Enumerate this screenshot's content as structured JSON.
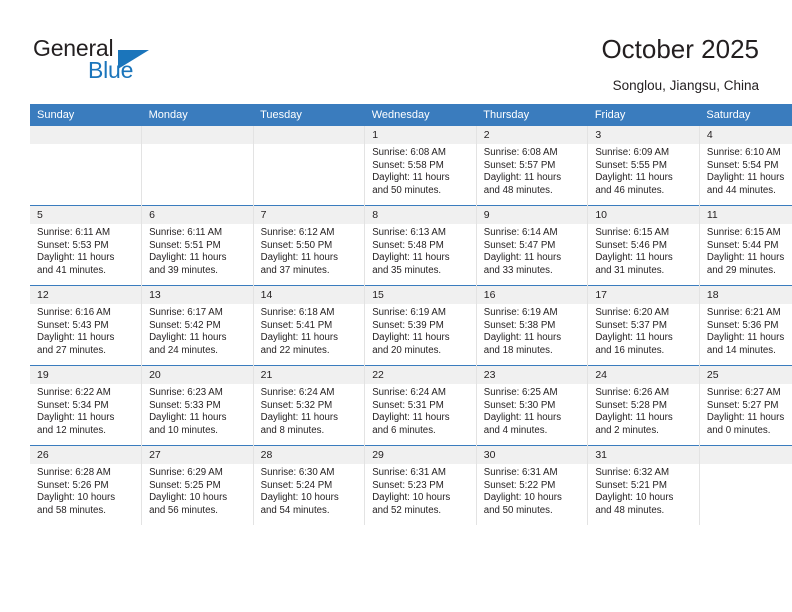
{
  "brand": {
    "name_top": "General",
    "name_bottom": "Blue",
    "accent_color": "#1b75bb"
  },
  "header": {
    "title": "October 2025",
    "subtitle": "Songlou, Jiangsu, China",
    "header_bg_color": "#3a7cbe",
    "daynum_band_color": "#f0f0f0"
  },
  "weekday_headers": [
    "Sunday",
    "Monday",
    "Tuesday",
    "Wednesday",
    "Thursday",
    "Friday",
    "Saturday"
  ],
  "weeks": [
    [
      {
        "day": "",
        "sunrise": "",
        "sunset": "",
        "daylight_line1": "",
        "daylight_line2": ""
      },
      {
        "day": "",
        "sunrise": "",
        "sunset": "",
        "daylight_line1": "",
        "daylight_line2": ""
      },
      {
        "day": "",
        "sunrise": "",
        "sunset": "",
        "daylight_line1": "",
        "daylight_line2": ""
      },
      {
        "day": "1",
        "sunrise": "Sunrise: 6:08 AM",
        "sunset": "Sunset: 5:58 PM",
        "daylight_line1": "Daylight: 11 hours",
        "daylight_line2": "and 50 minutes."
      },
      {
        "day": "2",
        "sunrise": "Sunrise: 6:08 AM",
        "sunset": "Sunset: 5:57 PM",
        "daylight_line1": "Daylight: 11 hours",
        "daylight_line2": "and 48 minutes."
      },
      {
        "day": "3",
        "sunrise": "Sunrise: 6:09 AM",
        "sunset": "Sunset: 5:55 PM",
        "daylight_line1": "Daylight: 11 hours",
        "daylight_line2": "and 46 minutes."
      },
      {
        "day": "4",
        "sunrise": "Sunrise: 6:10 AM",
        "sunset": "Sunset: 5:54 PM",
        "daylight_line1": "Daylight: 11 hours",
        "daylight_line2": "and 44 minutes."
      }
    ],
    [
      {
        "day": "5",
        "sunrise": "Sunrise: 6:11 AM",
        "sunset": "Sunset: 5:53 PM",
        "daylight_line1": "Daylight: 11 hours",
        "daylight_line2": "and 41 minutes."
      },
      {
        "day": "6",
        "sunrise": "Sunrise: 6:11 AM",
        "sunset": "Sunset: 5:51 PM",
        "daylight_line1": "Daylight: 11 hours",
        "daylight_line2": "and 39 minutes."
      },
      {
        "day": "7",
        "sunrise": "Sunrise: 6:12 AM",
        "sunset": "Sunset: 5:50 PM",
        "daylight_line1": "Daylight: 11 hours",
        "daylight_line2": "and 37 minutes."
      },
      {
        "day": "8",
        "sunrise": "Sunrise: 6:13 AM",
        "sunset": "Sunset: 5:48 PM",
        "daylight_line1": "Daylight: 11 hours",
        "daylight_line2": "and 35 minutes."
      },
      {
        "day": "9",
        "sunrise": "Sunrise: 6:14 AM",
        "sunset": "Sunset: 5:47 PM",
        "daylight_line1": "Daylight: 11 hours",
        "daylight_line2": "and 33 minutes."
      },
      {
        "day": "10",
        "sunrise": "Sunrise: 6:15 AM",
        "sunset": "Sunset: 5:46 PM",
        "daylight_line1": "Daylight: 11 hours",
        "daylight_line2": "and 31 minutes."
      },
      {
        "day": "11",
        "sunrise": "Sunrise: 6:15 AM",
        "sunset": "Sunset: 5:44 PM",
        "daylight_line1": "Daylight: 11 hours",
        "daylight_line2": "and 29 minutes."
      }
    ],
    [
      {
        "day": "12",
        "sunrise": "Sunrise: 6:16 AM",
        "sunset": "Sunset: 5:43 PM",
        "daylight_line1": "Daylight: 11 hours",
        "daylight_line2": "and 27 minutes."
      },
      {
        "day": "13",
        "sunrise": "Sunrise: 6:17 AM",
        "sunset": "Sunset: 5:42 PM",
        "daylight_line1": "Daylight: 11 hours",
        "daylight_line2": "and 24 minutes."
      },
      {
        "day": "14",
        "sunrise": "Sunrise: 6:18 AM",
        "sunset": "Sunset: 5:41 PM",
        "daylight_line1": "Daylight: 11 hours",
        "daylight_line2": "and 22 minutes."
      },
      {
        "day": "15",
        "sunrise": "Sunrise: 6:19 AM",
        "sunset": "Sunset: 5:39 PM",
        "daylight_line1": "Daylight: 11 hours",
        "daylight_line2": "and 20 minutes."
      },
      {
        "day": "16",
        "sunrise": "Sunrise: 6:19 AM",
        "sunset": "Sunset: 5:38 PM",
        "daylight_line1": "Daylight: 11 hours",
        "daylight_line2": "and 18 minutes."
      },
      {
        "day": "17",
        "sunrise": "Sunrise: 6:20 AM",
        "sunset": "Sunset: 5:37 PM",
        "daylight_line1": "Daylight: 11 hours",
        "daylight_line2": "and 16 minutes."
      },
      {
        "day": "18",
        "sunrise": "Sunrise: 6:21 AM",
        "sunset": "Sunset: 5:36 PM",
        "daylight_line1": "Daylight: 11 hours",
        "daylight_line2": "and 14 minutes."
      }
    ],
    [
      {
        "day": "19",
        "sunrise": "Sunrise: 6:22 AM",
        "sunset": "Sunset: 5:34 PM",
        "daylight_line1": "Daylight: 11 hours",
        "daylight_line2": "and 12 minutes."
      },
      {
        "day": "20",
        "sunrise": "Sunrise: 6:23 AM",
        "sunset": "Sunset: 5:33 PM",
        "daylight_line1": "Daylight: 11 hours",
        "daylight_line2": "and 10 minutes."
      },
      {
        "day": "21",
        "sunrise": "Sunrise: 6:24 AM",
        "sunset": "Sunset: 5:32 PM",
        "daylight_line1": "Daylight: 11 hours",
        "daylight_line2": "and 8 minutes."
      },
      {
        "day": "22",
        "sunrise": "Sunrise: 6:24 AM",
        "sunset": "Sunset: 5:31 PM",
        "daylight_line1": "Daylight: 11 hours",
        "daylight_line2": "and 6 minutes."
      },
      {
        "day": "23",
        "sunrise": "Sunrise: 6:25 AM",
        "sunset": "Sunset: 5:30 PM",
        "daylight_line1": "Daylight: 11 hours",
        "daylight_line2": "and 4 minutes."
      },
      {
        "day": "24",
        "sunrise": "Sunrise: 6:26 AM",
        "sunset": "Sunset: 5:28 PM",
        "daylight_line1": "Daylight: 11 hours",
        "daylight_line2": "and 2 minutes."
      },
      {
        "day": "25",
        "sunrise": "Sunrise: 6:27 AM",
        "sunset": "Sunset: 5:27 PM",
        "daylight_line1": "Daylight: 11 hours",
        "daylight_line2": "and 0 minutes."
      }
    ],
    [
      {
        "day": "26",
        "sunrise": "Sunrise: 6:28 AM",
        "sunset": "Sunset: 5:26 PM",
        "daylight_line1": "Daylight: 10 hours",
        "daylight_line2": "and 58 minutes."
      },
      {
        "day": "27",
        "sunrise": "Sunrise: 6:29 AM",
        "sunset": "Sunset: 5:25 PM",
        "daylight_line1": "Daylight: 10 hours",
        "daylight_line2": "and 56 minutes."
      },
      {
        "day": "28",
        "sunrise": "Sunrise: 6:30 AM",
        "sunset": "Sunset: 5:24 PM",
        "daylight_line1": "Daylight: 10 hours",
        "daylight_line2": "and 54 minutes."
      },
      {
        "day": "29",
        "sunrise": "Sunrise: 6:31 AM",
        "sunset": "Sunset: 5:23 PM",
        "daylight_line1": "Daylight: 10 hours",
        "daylight_line2": "and 52 minutes."
      },
      {
        "day": "30",
        "sunrise": "Sunrise: 6:31 AM",
        "sunset": "Sunset: 5:22 PM",
        "daylight_line1": "Daylight: 10 hours",
        "daylight_line2": "and 50 minutes."
      },
      {
        "day": "31",
        "sunrise": "Sunrise: 6:32 AM",
        "sunset": "Sunset: 5:21 PM",
        "daylight_line1": "Daylight: 10 hours",
        "daylight_line2": "and 48 minutes."
      },
      {
        "day": "",
        "sunrise": "",
        "sunset": "",
        "daylight_line1": "",
        "daylight_line2": ""
      }
    ]
  ]
}
